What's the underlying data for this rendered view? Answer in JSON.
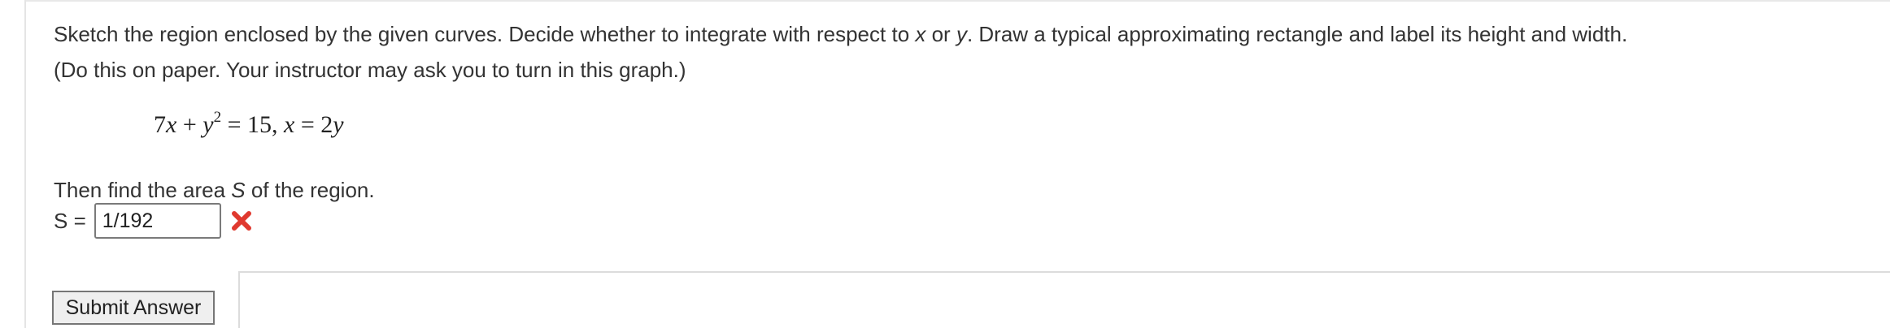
{
  "question": {
    "prompt_before_x": "Sketch the region enclosed by the given curves. Decide whether to integrate with respect to ",
    "var_x": "x",
    "prompt_or": " or ",
    "var_y": "y",
    "prompt_after_y": ". Draw a typical approximating rectangle and label its height and width.",
    "prompt_line2": "(Do this on paper. Your instructor may ask you to turn in this graph.)",
    "equation": {
      "coef_7": "7",
      "x1": "x",
      "plus": " + ",
      "y1": "y",
      "exp2": "2",
      "eq1": " = 15, ",
      "x2": "x",
      "eq2": " = 2",
      "y2": "y"
    },
    "followup_before": "Then find the area ",
    "followup_var": "S",
    "followup_after": " of the region."
  },
  "answer": {
    "label": "S =",
    "value": "1/192",
    "status_icon": "red-x-icon",
    "status": "incorrect",
    "status_color": "#e0392f"
  },
  "actions": {
    "submit_label": "Submit Answer"
  }
}
